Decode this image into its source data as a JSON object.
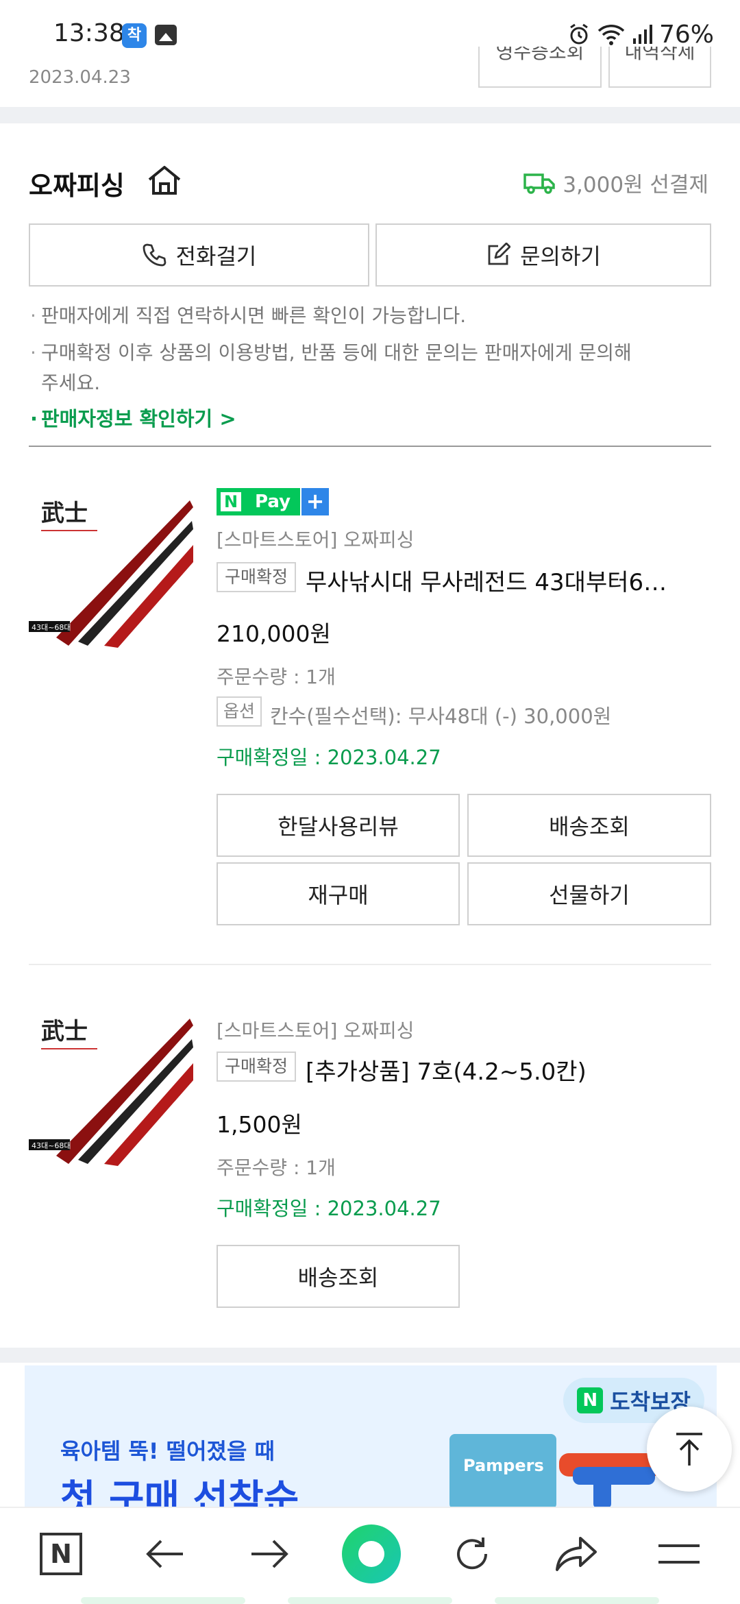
{
  "status_bar": {
    "time": "13:38",
    "app_badge": "착",
    "battery": "76%"
  },
  "top": {
    "date": "2023.04.23",
    "receipt_button": "영수증조회",
    "delete_button": "내역삭제"
  },
  "seller": {
    "name": "오짜피싱",
    "shipping": "3,000원 선결제",
    "call_button": "전화걸기",
    "inquiry_button": "문의하기",
    "notes": [
      "판매자에게 직접 연락하시면 빠른 확인이 가능합니다.",
      "구매확정 이후 상품의 이용방법, 반품 등에 대한 문의는 판매자에게 문의해",
      "주세요."
    ],
    "info_link": "판매자정보 확인하기 >"
  },
  "products": [
    {
      "npay_pay": "Pay",
      "npay_plus": "+",
      "store": "[스마트스토어] 오짜피싱",
      "status": "구매확정",
      "name": "무사낚시대 무사레전드 43대부터6…",
      "price": "210,000원",
      "quantity": "주문수량 : 1개",
      "option_label": "옵션",
      "option_text": "칸수(필수선택): 무사48대 (-) 30,000원",
      "confirm_date": "구매확정일 : 2023.04.27",
      "buttons": [
        "한달사용리뷰",
        "배송조회",
        "재구매",
        "선물하기"
      ]
    },
    {
      "store": "[스마트스토어] 오짜피싱",
      "status": "구매확정",
      "name": "[추가상품] 7호(4.2~5.0칸)",
      "price": "1,500원",
      "quantity": "주문수량 : 1개",
      "confirm_date": "구매확정일 : 2023.04.27",
      "buttons": [
        "배송조회"
      ]
    }
  ],
  "thumb": {
    "logo": "武士",
    "tag": "43대~68대"
  },
  "ad": {
    "badge": "도착보장",
    "badge_mark": "N",
    "subtitle": "육아템 뚝! 떨어졌을 때",
    "title": "첫 구매 선착순",
    "pack_label": "Pampers"
  },
  "bottom_nav": {
    "home_label": "N"
  },
  "colors": {
    "green": "#03c75a",
    "link_green": "#0a9c4e",
    "blue": "#1d4ee0"
  }
}
